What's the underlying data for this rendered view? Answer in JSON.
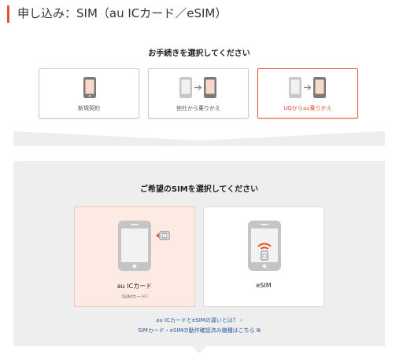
{
  "header": {
    "title": "申し込み：SIM（au ICカード／eSIM）"
  },
  "procedure": {
    "title": "お手続きを選択してください",
    "options": [
      {
        "label": "新規契約",
        "selected": false
      },
      {
        "label": "他社から乗りかえ",
        "selected": false
      },
      {
        "label": "UQからau乗りかえ",
        "selected": true
      }
    ]
  },
  "sim": {
    "title": "ご希望のSIMを選択してください",
    "options": [
      {
        "label": "au ICカード",
        "sublabel": "（SIMカード）",
        "selected": true
      },
      {
        "label": "eSIM",
        "sublabel": "",
        "selected": false
      }
    ],
    "links": [
      {
        "label": "au ICカードとeSIMの違いとは？ ›"
      },
      {
        "label": "SIMカード・eSIMの動作確認済み機種はこちら ⧉"
      }
    ]
  },
  "colors": {
    "accent": "#e8532b",
    "link": "#2c5d9c",
    "panel": "#eeeeee",
    "selected_bg": "#fdebe3"
  }
}
